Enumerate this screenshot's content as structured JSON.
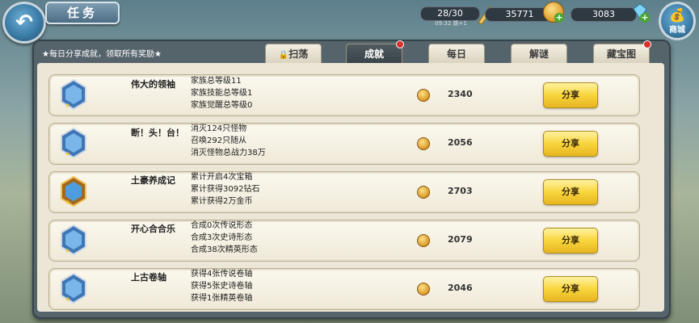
{
  "header": {
    "title": "任务",
    "back_label": "↶",
    "stamina": "28/30",
    "timer": "09:32 跳+1",
    "gold": "35771",
    "diamonds": "3083",
    "shop_label": "商城"
  },
  "panel": {
    "tip": "★每日分享成就，领取所有奖励★",
    "tabs": [
      {
        "label": "扫荡",
        "active": false,
        "dot": false
      },
      {
        "label": "成就",
        "active": true,
        "dot": true
      },
      {
        "label": "每日",
        "active": false,
        "dot": false
      },
      {
        "label": "解谜",
        "active": false,
        "dot": false
      },
      {
        "label": "藏宝图",
        "active": false,
        "dot": true
      }
    ]
  },
  "achievements": [
    {
      "title": "伟大的领袖",
      "lines": [
        "家族总等级11",
        "家族技能总等级1",
        "家族觉醒总等级0"
      ],
      "amount": "2340",
      "share": "分享",
      "medal": "blue"
    },
    {
      "title": "断！头！台！",
      "lines": [
        "消灭124只怪物",
        "召唤292只随从",
        "消灭怪物总战力38万"
      ],
      "amount": "2056",
      "share": "分享",
      "medal": "blue"
    },
    {
      "title": "土豪养成记",
      "lines": [
        "累计开启4次宝箱",
        "累计获得3092钻石",
        "累计获得2万金币"
      ],
      "amount": "2703",
      "share": "分享",
      "medal": "gold"
    },
    {
      "title": "开心合合乐",
      "lines": [
        "合成0次传说形态",
        "合成3次史诗形态",
        "合成38次精英形态"
      ],
      "amount": "2079",
      "share": "分享",
      "medal": "blue"
    },
    {
      "title": "上古卷轴",
      "lines": [
        "获得4张传说卷轴",
        "获得5张史诗卷轴",
        "获得1张精英卷轴"
      ],
      "amount": "2046",
      "share": "分享",
      "medal": "blue"
    }
  ]
}
